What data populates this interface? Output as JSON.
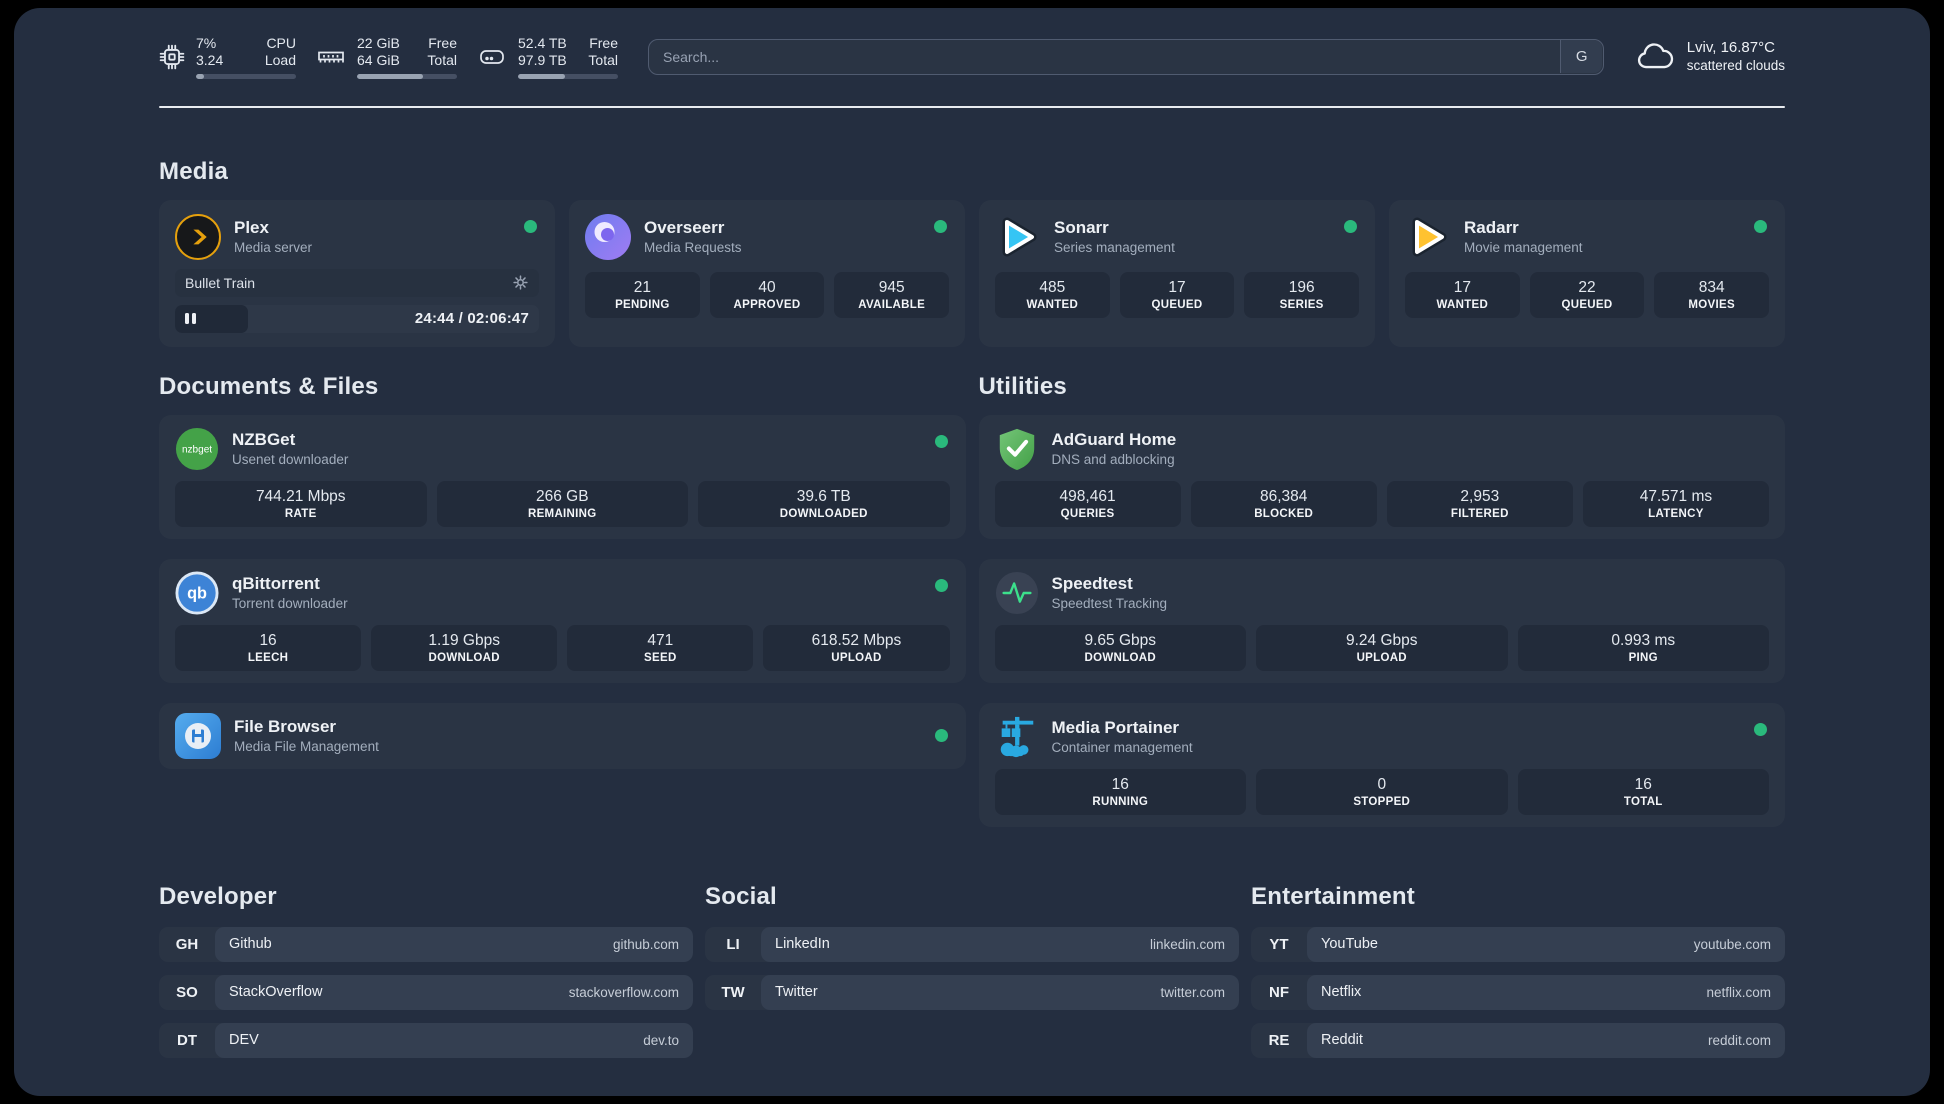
{
  "colors": {
    "background": "#242e40",
    "card": "#2a3444",
    "stat_box": "#222b3a",
    "accent_green": "#2ab97c",
    "plex_gold": "#e5a00d",
    "sonarr_blue": "#35c5f4",
    "radarr_orange": "#ffc230",
    "nzbget_green": "#44a248",
    "qbittorrent_blue": "#3d83d6",
    "filebrowser_blue": "#2d7dd2",
    "adguard_green": "#52ab57",
    "speedtest_green": "#3ce08c",
    "portainer_blue": "#29a9e1"
  },
  "topbar": {
    "cpu": {
      "value_top": "7%",
      "value_bottom": "3.24",
      "label_top": "CPU",
      "label_bottom": "Load",
      "progress": 8
    },
    "memory": {
      "value_top": "22 GiB",
      "value_bottom": "64 GiB",
      "label_top": "Free",
      "label_bottom": "Total",
      "progress": 66
    },
    "disk": {
      "value_top": "52.4 TB",
      "value_bottom": "97.9 TB",
      "label_top": "Free",
      "label_bottom": "Total",
      "progress": 47
    },
    "search": {
      "placeholder": "Search...",
      "engine_label": "G"
    },
    "weather": {
      "location": "Lviv, 16.87°C",
      "condition": "scattered clouds"
    }
  },
  "media": {
    "header": "Media",
    "plex": {
      "title": "Plex",
      "subtitle": "Media server",
      "now_playing": "Bullet Train",
      "time": "24:44 / 02:06:47",
      "progress": 20
    },
    "overseerr": {
      "title": "Overseerr",
      "subtitle": "Media Requests",
      "stats": [
        {
          "value": "21",
          "label": "PENDING"
        },
        {
          "value": "40",
          "label": "APPROVED"
        },
        {
          "value": "945",
          "label": "AVAILABLE"
        }
      ]
    },
    "sonarr": {
      "title": "Sonarr",
      "subtitle": "Series management",
      "stats": [
        {
          "value": "485",
          "label": "WANTED"
        },
        {
          "value": "17",
          "label": "QUEUED"
        },
        {
          "value": "196",
          "label": "SERIES"
        }
      ]
    },
    "radarr": {
      "title": "Radarr",
      "subtitle": "Movie management",
      "stats": [
        {
          "value": "17",
          "label": "WANTED"
        },
        {
          "value": "22",
          "label": "QUEUED"
        },
        {
          "value": "834",
          "label": "MOVIES"
        }
      ]
    }
  },
  "documents": {
    "header": "Documents & Files",
    "nzbget": {
      "title": "NZBGet",
      "subtitle": "Usenet downloader",
      "icon_text": "nzbget",
      "stats": [
        {
          "value": "744.21 Mbps",
          "label": "RATE"
        },
        {
          "value": "266 GB",
          "label": "REMAINING"
        },
        {
          "value": "39.6 TB",
          "label": "DOWNLOADED"
        }
      ]
    },
    "qbittorrent": {
      "title": "qBittorrent",
      "subtitle": "Torrent downloader",
      "icon_text": "qb",
      "stats": [
        {
          "value": "16",
          "label": "LEECH"
        },
        {
          "value": "1.19 Gbps",
          "label": "DOWNLOAD"
        },
        {
          "value": "471",
          "label": "SEED"
        },
        {
          "value": "618.52 Mbps",
          "label": "UPLOAD"
        }
      ]
    },
    "filebrowser": {
      "title": "File Browser",
      "subtitle": "Media File Management"
    }
  },
  "utilities": {
    "header": "Utilities",
    "adguard": {
      "title": "AdGuard Home",
      "subtitle": "DNS and adblocking",
      "stats": [
        {
          "value": "498,461",
          "label": "QUERIES"
        },
        {
          "value": "86,384",
          "label": "BLOCKED"
        },
        {
          "value": "2,953",
          "label": "FILTERED"
        },
        {
          "value": "47.571 ms",
          "label": "LATENCY"
        }
      ]
    },
    "speedtest": {
      "title": "Speedtest",
      "subtitle": "Speedtest Tracking",
      "stats": [
        {
          "value": "9.65 Gbps",
          "label": "DOWNLOAD"
        },
        {
          "value": "9.24 Gbps",
          "label": "UPLOAD"
        },
        {
          "value": "0.993 ms",
          "label": "PING"
        }
      ]
    },
    "portainer": {
      "title": "Media Portainer",
      "subtitle": "Container management",
      "stats": [
        {
          "value": "16",
          "label": "RUNNING"
        },
        {
          "value": "0",
          "label": "STOPPED"
        },
        {
          "value": "16",
          "label": "TOTAL"
        }
      ]
    }
  },
  "bookmarks": {
    "developer": {
      "header": "Developer",
      "items": [
        {
          "abbr": "GH",
          "name": "Github",
          "url": "github.com"
        },
        {
          "abbr": "SO",
          "name": "StackOverflow",
          "url": "stackoverflow.com"
        },
        {
          "abbr": "DT",
          "name": "DEV",
          "url": "dev.to"
        }
      ]
    },
    "social": {
      "header": "Social",
      "items": [
        {
          "abbr": "LI",
          "name": "LinkedIn",
          "url": "linkedin.com"
        },
        {
          "abbr": "TW",
          "name": "Twitter",
          "url": "twitter.com"
        }
      ]
    },
    "entertainment": {
      "header": "Entertainment",
      "items": [
        {
          "abbr": "YT",
          "name": "YouTube",
          "url": "youtube.com"
        },
        {
          "abbr": "NF",
          "name": "Netflix",
          "url": "netflix.com"
        },
        {
          "abbr": "RE",
          "name": "Reddit",
          "url": "reddit.com"
        }
      ]
    }
  }
}
